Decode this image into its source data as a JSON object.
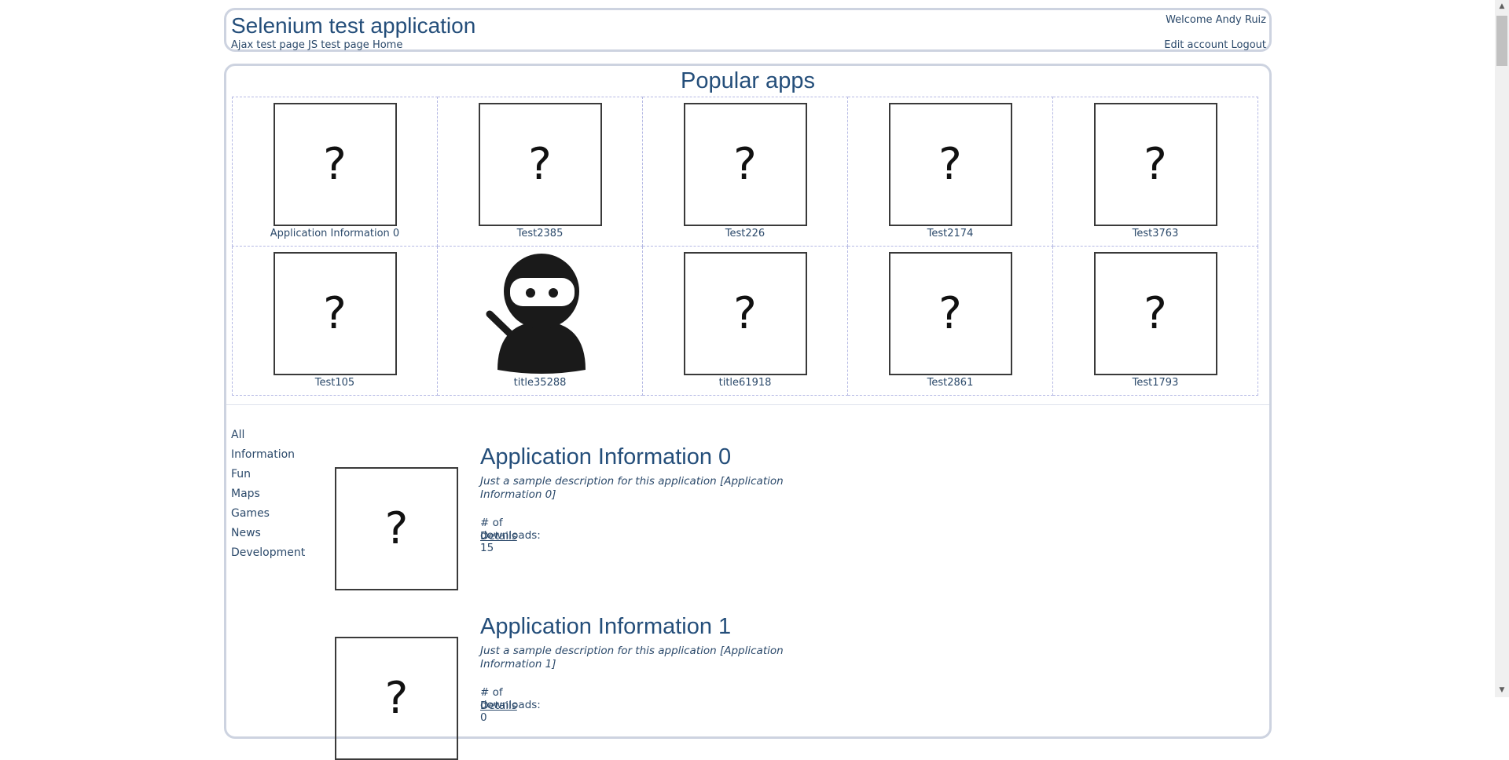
{
  "header": {
    "title": "Selenium test application",
    "nav": [
      "Ajax test page",
      "JS test page",
      "Home"
    ],
    "welcome": "Welcome Andy Ruiz",
    "account_links": [
      "Edit account",
      "Logout"
    ]
  },
  "popular": {
    "title": "Popular apps",
    "placeholder_glyph": "?",
    "apps": [
      {
        "name": "Application Information 0",
        "icon": "question-mark-icon"
      },
      {
        "name": "Test2385",
        "icon": "question-mark-icon"
      },
      {
        "name": "Test226",
        "icon": "question-mark-icon"
      },
      {
        "name": "Test2174",
        "icon": "question-mark-icon"
      },
      {
        "name": "Test3763",
        "icon": "question-mark-icon"
      },
      {
        "name": "Test105",
        "icon": "question-mark-icon"
      },
      {
        "name": "title35288",
        "icon": "ninja-icon"
      },
      {
        "name": "title61918",
        "icon": "question-mark-icon"
      },
      {
        "name": "Test2861",
        "icon": "question-mark-icon"
      },
      {
        "name": "Test1793",
        "icon": "question-mark-icon"
      }
    ]
  },
  "categories": [
    "All",
    "Information",
    "Fun",
    "Maps",
    "Games",
    "News",
    "Development"
  ],
  "applications": [
    {
      "title": "Application Information 0",
      "description": "Just a sample description for this application [Application Information 0]",
      "downloads": "# of downloads: 15",
      "details": "Details"
    },
    {
      "title": "Application Information 1",
      "description": "Just a sample description for this application [Application Information 1]",
      "downloads": "# of downloads: 0",
      "details": "Details"
    }
  ],
  "colors": {
    "text": "#2c4a6b",
    "title": "#244e7a",
    "panel_border": "#cdd3e0",
    "cell_border": "#b5b9e4"
  }
}
